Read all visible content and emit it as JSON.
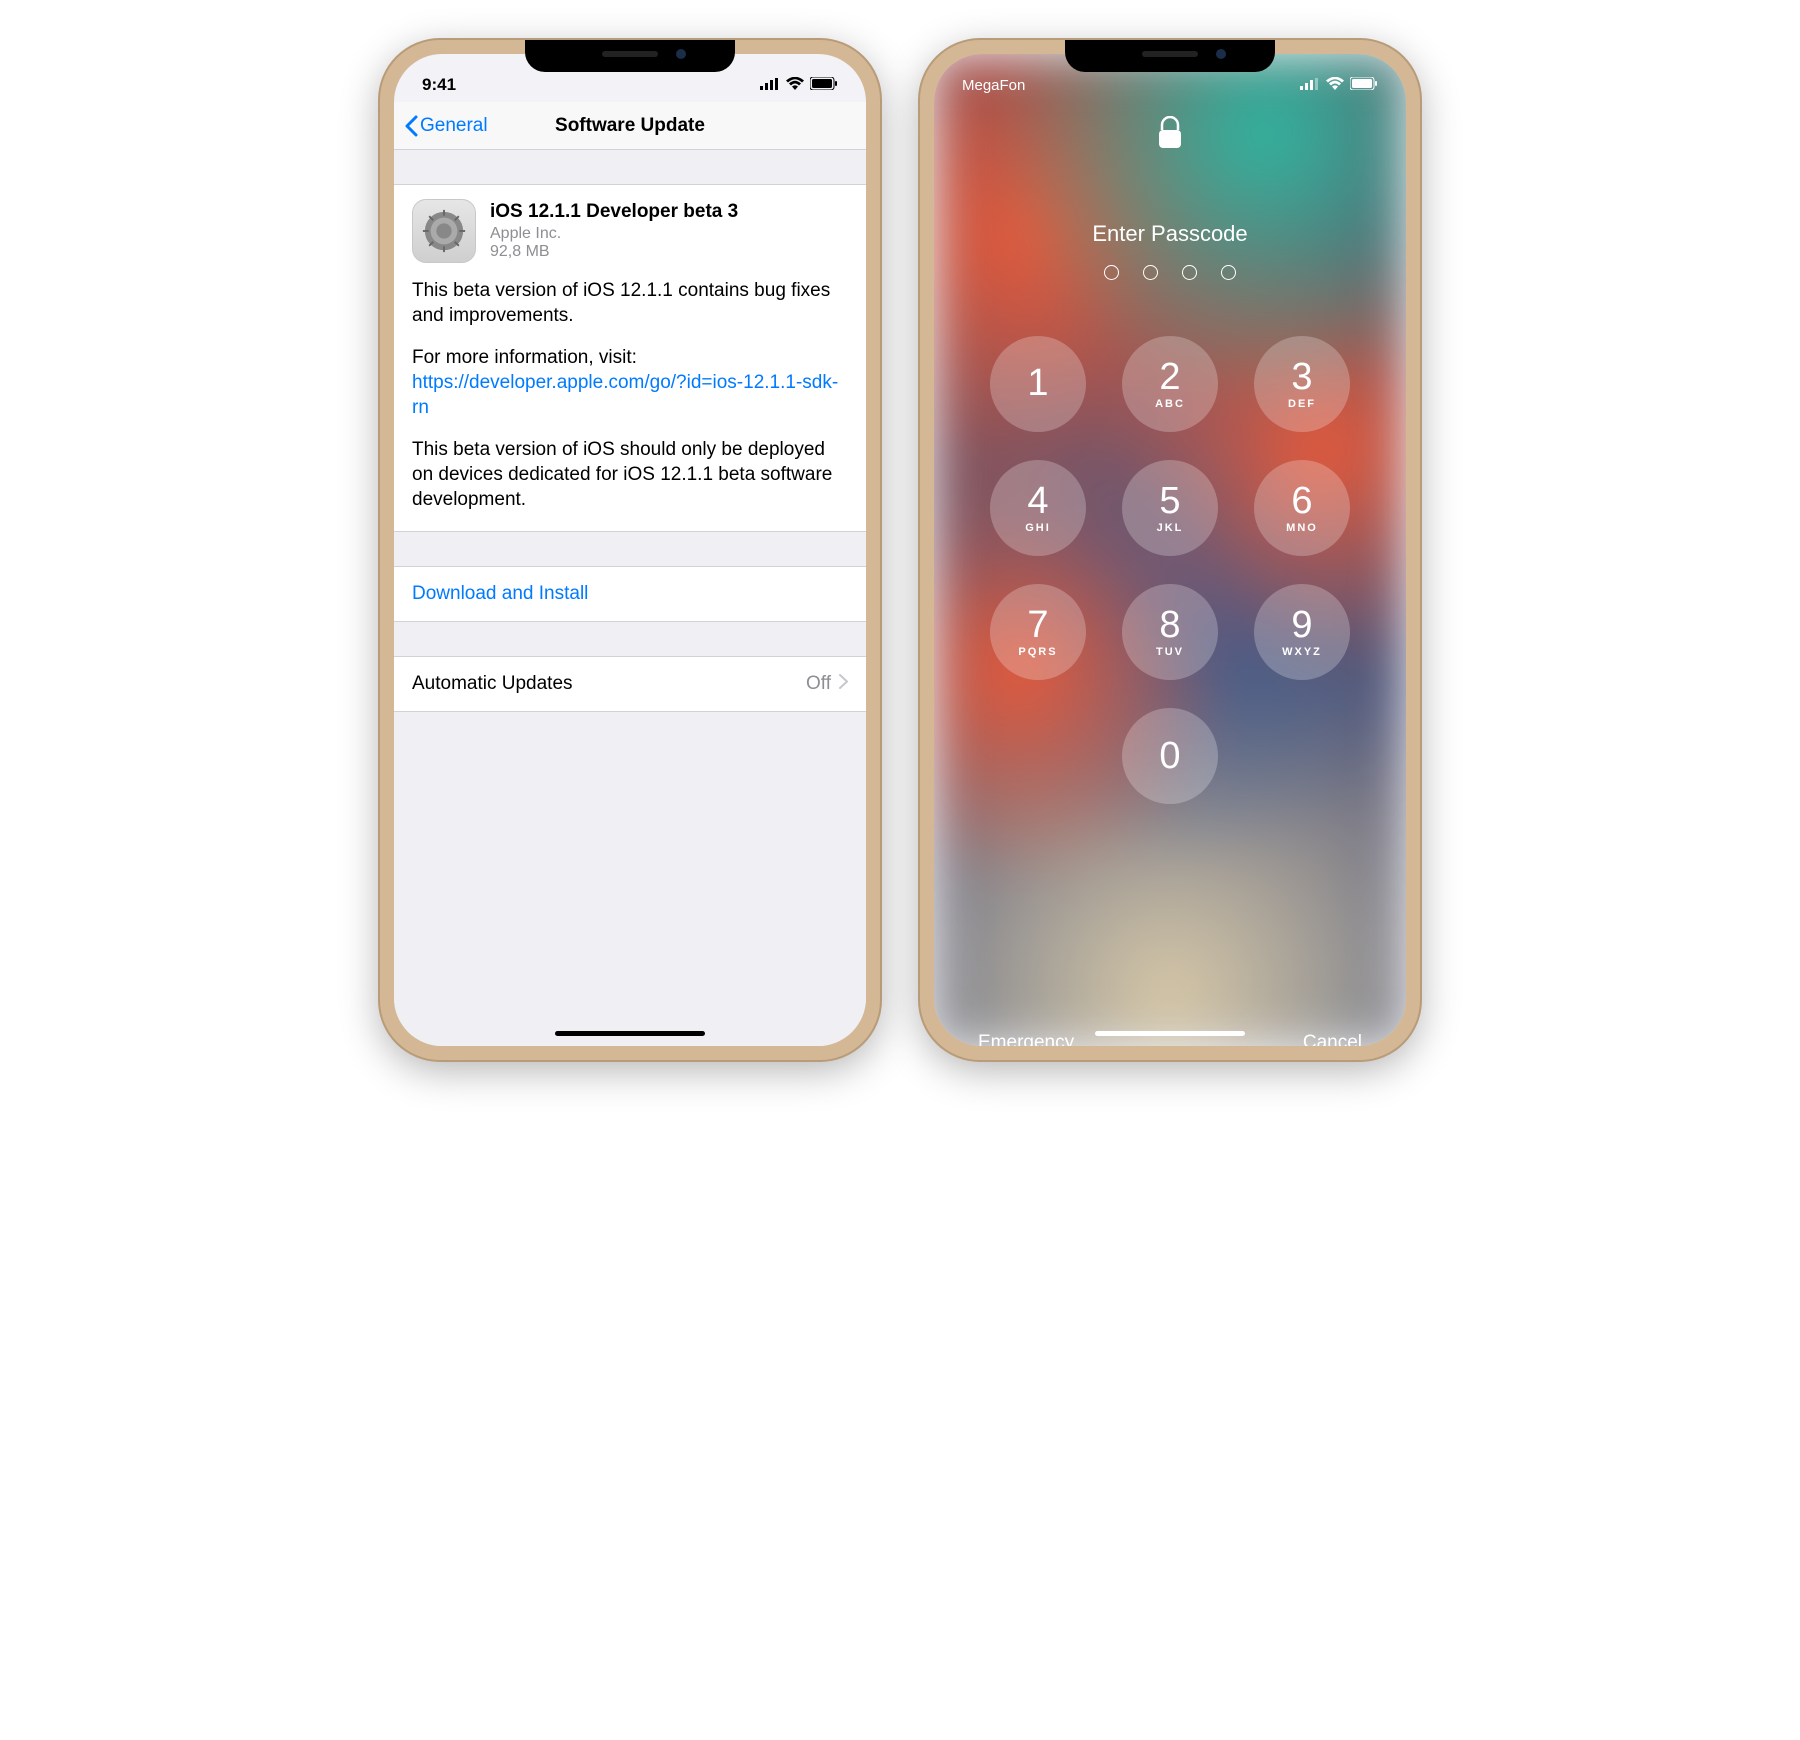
{
  "left": {
    "status": {
      "time": "9:41"
    },
    "nav": {
      "back": "General",
      "title": "Software Update"
    },
    "update": {
      "title": "iOS 12.1.1 Developer beta 3",
      "vendor": "Apple Inc.",
      "size": "92,8 MB",
      "desc1": "This beta version of iOS 12.1.1 contains bug fixes and improvements.",
      "desc2_prefix": "For more information, visit:",
      "desc2_link": "https://developer.apple.com/go/?id=ios-12.1.1-sdk-rn",
      "desc3": "This beta version of iOS should only be deployed on devices dedicated for iOS 12.1.1 beta software development."
    },
    "download_action": "Download and Install",
    "auto_updates": {
      "label": "Automatic Updates",
      "value": "Off"
    }
  },
  "right": {
    "status": {
      "carrier": "MegaFon"
    },
    "prompt": "Enter Passcode",
    "passcode_length": 4,
    "keypad": [
      {
        "num": "1",
        "letters": ""
      },
      {
        "num": "2",
        "letters": "ABC"
      },
      {
        "num": "3",
        "letters": "DEF"
      },
      {
        "num": "4",
        "letters": "GHI"
      },
      {
        "num": "5",
        "letters": "JKL"
      },
      {
        "num": "6",
        "letters": "MNO"
      },
      {
        "num": "7",
        "letters": "PQRS"
      },
      {
        "num": "8",
        "letters": "TUV"
      },
      {
        "num": "9",
        "letters": "WXYZ"
      },
      {
        "num": "0",
        "letters": ""
      }
    ],
    "emergency": "Emergency",
    "cancel": "Cancel"
  }
}
